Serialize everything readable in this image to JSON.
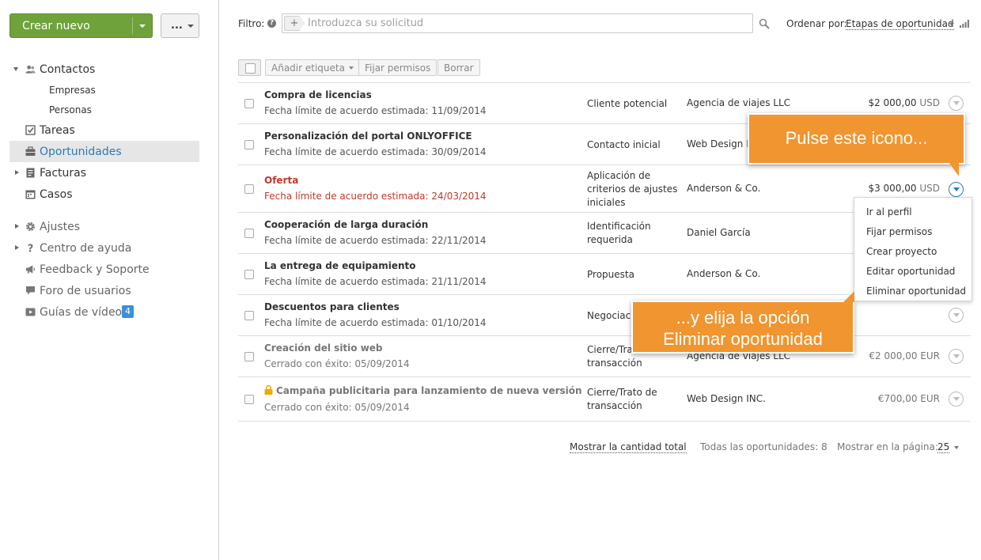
{
  "sidebar": {
    "create_label": "Crear nuevo",
    "more_label": "...",
    "nav": {
      "contactos": "Contactos",
      "empresas": "Empresas",
      "personas": "Personas",
      "tareas": "Tareas",
      "oportunidades": "Oportunidades",
      "facturas": "Facturas",
      "casos": "Casos",
      "ajustes": "Ajustes",
      "centro_ayuda": "Centro de ayuda",
      "feedback": "Feedback y Soporte",
      "foro": "Foro de usuarios",
      "guias": "Guías de vídeo",
      "guias_badge": "4"
    }
  },
  "filter": {
    "label": "Filtro:",
    "help": "?",
    "plus": "+",
    "placeholder": "Introduzca su solicitud",
    "sort_label": "Ordenar por:",
    "sort_value": "Etapas de oportunidad"
  },
  "toolbar": {
    "add_tag": "Añadir etiqueta",
    "set_permissions": "Fijar permisos",
    "delete": "Borrar"
  },
  "rows": [
    {
      "title": "Compra de licencias",
      "sub": "Fecha límite de acuerdo estimada: 11/09/2014",
      "stage": "Cliente potencial",
      "contact": "Agencia de viajes LLC",
      "amount": "$2 000,00",
      "currency": "USD"
    },
    {
      "title": "Personalización del portal ONLYOFFICE",
      "sub": "Fecha límite de acuerdo estimada: 30/09/2014",
      "stage": "Contacto inicial",
      "contact": "Web Design I",
      "amount": "",
      "currency": ""
    },
    {
      "title": "Oferta",
      "sub": "Fecha límite de acuerdo estimada: 24/03/2014",
      "stage": "Aplicación de criterios de ajustes iniciales",
      "contact": "Anderson & Co.",
      "amount": "$3 000,00",
      "currency": "USD"
    },
    {
      "title": "Cooperación de larga duración",
      "sub": "Fecha límite de acuerdo estimada: 22/11/2014",
      "stage": "Identificación requerida",
      "contact": "Daniel García",
      "amount": "",
      "currency": ""
    },
    {
      "title": "La entrega de equipamiento",
      "sub": "Fecha límite de acuerdo estimada: 21/11/2014",
      "stage": "Propuesta",
      "contact": "Anderson & Co.",
      "amount": "",
      "currency": ""
    },
    {
      "title": "Descuentos para clientes",
      "sub": "Fecha límite de acuerdo estimada: 01/10/2014",
      "stage": "Negociac",
      "contact": "",
      "amount": "",
      "currency": ""
    },
    {
      "title": "Creación del sitio web",
      "sub": "Cerrado con éxito: 05/09/2014",
      "stage": "Cierre/Trato transacción",
      "contact": "Agencia de viajes LLC",
      "amount": "€2 000,00",
      "currency": "EUR"
    },
    {
      "title": "Campaña publicitaria para lanzamiento de nueva versión",
      "sub": "Cerrado con éxito: 05/09/2014",
      "stage": "Cierre/Trato de transacción",
      "contact": "Web Design INC.",
      "amount": "€700,00",
      "currency": "EUR"
    }
  ],
  "dropdown": {
    "items": [
      "Ir al perfil",
      "Fijar permisos",
      "Crear proyecto",
      "Editar oportunidad",
      "Eliminar oportunidad"
    ]
  },
  "callouts": {
    "first": "Pulse este icono...",
    "second_line1": "...y elija la opción",
    "second_line2": "Eliminar oportunidad"
  },
  "footer": {
    "show_total": "Mostrar la cantidad total",
    "all_count": "Todas las oportunidades: 8",
    "per_page_label": "Mostrar en la página:",
    "per_page_value": "25"
  },
  "colors": {
    "accent_green": "#6fa23a",
    "link_blue": "#2b7bb4",
    "overdue_red": "#c0392b",
    "callout_orange": "#f0952f"
  }
}
